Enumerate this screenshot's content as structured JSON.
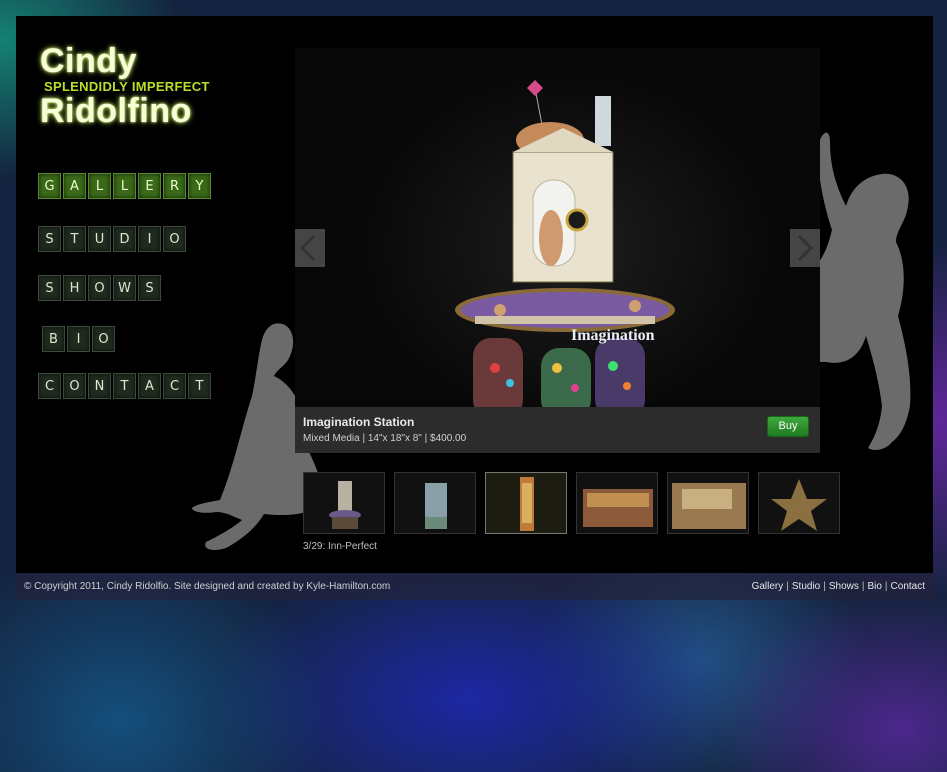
{
  "logo": {
    "line1": "Cindy",
    "tagline": "SPLENDIDLY IMPERFECT",
    "line2": "Ridolfino"
  },
  "nav": [
    {
      "label": "GALLERY",
      "letters": [
        "G",
        "A",
        "L",
        "L",
        "E",
        "R",
        "Y"
      ],
      "active": true
    },
    {
      "label": "STUDIO",
      "letters": [
        "S",
        "T",
        "U",
        "D",
        "I",
        "O"
      ],
      "active": false
    },
    {
      "label": "SHOWS",
      "letters": [
        "S",
        "H",
        "O",
        "W",
        "S"
      ],
      "active": false
    },
    {
      "label": "BIO",
      "letters": [
        "B",
        "I",
        "O"
      ],
      "active": false
    },
    {
      "label": "CONTACT",
      "letters": [
        "C",
        "O",
        "N",
        "T",
        "A",
        "C",
        "T"
      ],
      "active": false
    }
  ],
  "artwork": {
    "title": "Imagination Station",
    "details": "Mixed Media | 14\"x 18\"x 8\" | $400.00",
    "sign_text": "Imagination",
    "buy_label": "Buy"
  },
  "thumbnails": [
    {
      "name": "thumbnail-1",
      "current": false
    },
    {
      "name": "thumbnail-2",
      "current": false
    },
    {
      "name": "thumbnail-3",
      "current": true
    },
    {
      "name": "thumbnail-4",
      "current": false
    },
    {
      "name": "thumbnail-5",
      "current": false
    },
    {
      "name": "thumbnail-6",
      "current": false
    }
  ],
  "counter": "3/29: Inn-Perfect",
  "footer": {
    "copyright": "© Copyright 2011, Cindy Ridolfio. Site designed and created by Kyle-Hamilton.com",
    "links": [
      "Gallery",
      "Studio",
      "Shows",
      "Bio",
      "Contact"
    ]
  },
  "colors": {
    "accent": "#b8e02a",
    "buy": "#2f9a2f",
    "frame": "#000000"
  }
}
